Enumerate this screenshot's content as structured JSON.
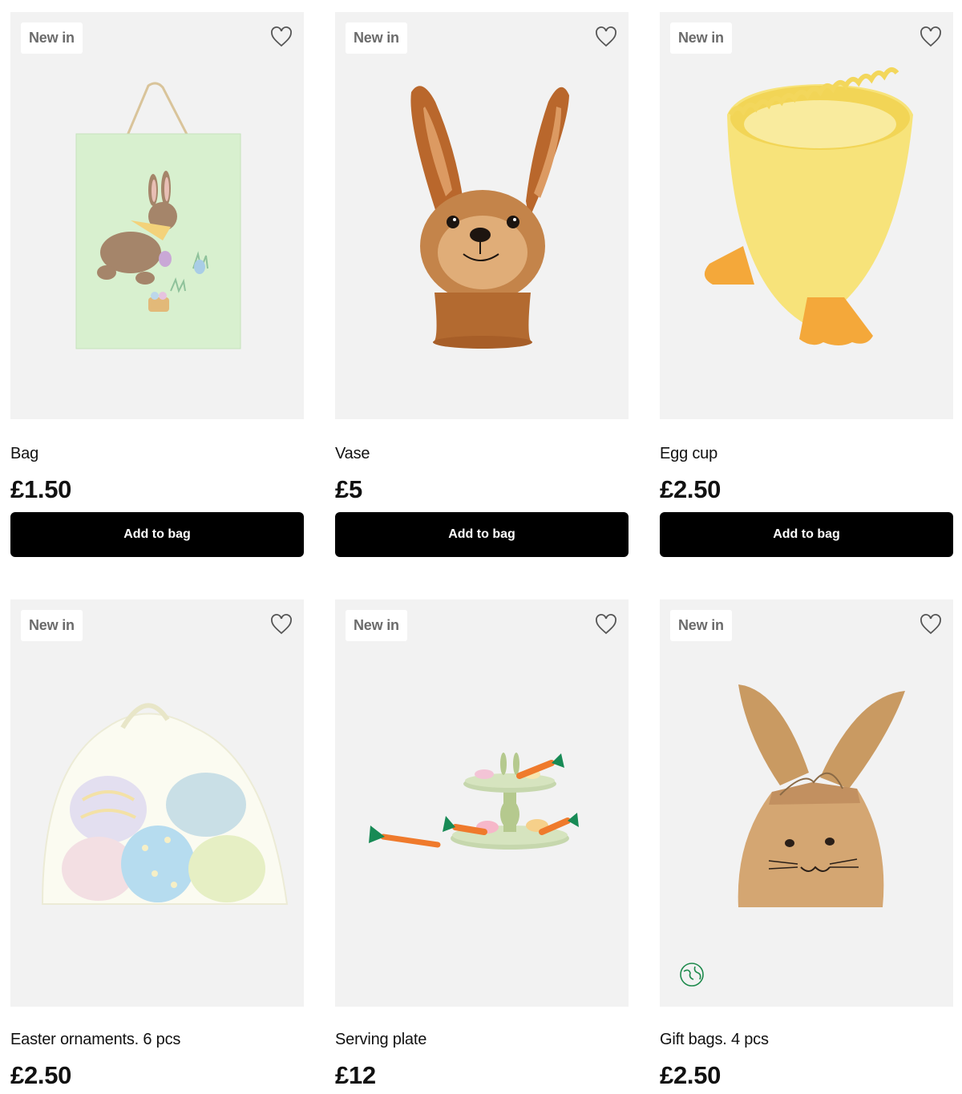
{
  "products": [
    {
      "badge": "New in",
      "name": "Bag",
      "price": "£1.50",
      "button": "Add to bag"
    },
    {
      "badge": "New in",
      "name": "Vase",
      "price": "£5",
      "button": "Add to bag"
    },
    {
      "badge": "New in",
      "name": "Egg cup",
      "price": "£2.50",
      "button": "Add to bag"
    },
    {
      "badge": "New in",
      "name": "Easter ornaments. 6 pcs",
      "price": "£2.50"
    },
    {
      "badge": "New in",
      "name": "Serving plate",
      "price": "£12"
    },
    {
      "badge": "New in",
      "name": "Gift bags. 4 pcs",
      "price": "£2.50"
    }
  ],
  "colors": {
    "button_bg": "#000000",
    "tile_bg": "#f2f2f2",
    "badge_text": "#6b6b6b"
  },
  "icons": [
    "heart-outline-icon",
    "eco-globe-icon"
  ]
}
